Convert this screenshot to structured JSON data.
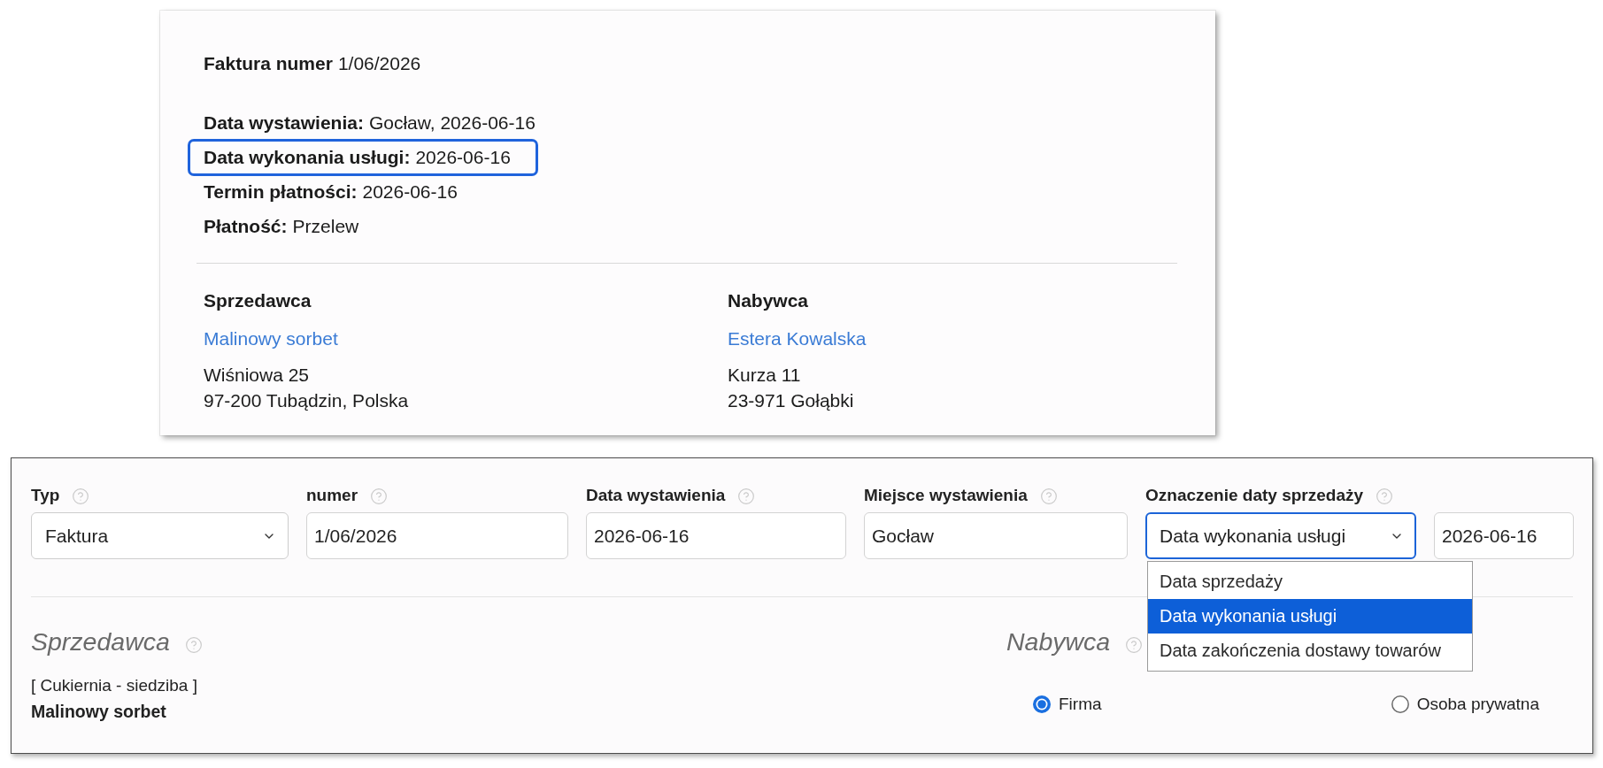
{
  "invoice_preview": {
    "title": {
      "label": "Faktura numer",
      "value": "1/06/2026"
    },
    "details": [
      {
        "label": "Data wystawienia:",
        "value": "Gocław, 2026-06-16",
        "highlighted": false
      },
      {
        "label": "Data wykonania usługi:",
        "value": "2026-06-16",
        "highlighted": true
      },
      {
        "label": "Termin płatności:",
        "value": "2026-06-16",
        "highlighted": false
      },
      {
        "label": "Płatność:",
        "value": "Przelew",
        "highlighted": false
      }
    ],
    "parties": [
      {
        "heading": "Sprzedawca",
        "name": "Malinowy sorbet",
        "address_lines": [
          "Wiśniowa 25",
          "97-200 Tubądzin, Polska"
        ]
      },
      {
        "heading": "Nabywca",
        "name": "Estera Kowalska",
        "address_lines": [
          "Kurza 11",
          "23-971 Gołąbki"
        ]
      }
    ]
  },
  "form": {
    "fields": [
      {
        "kind": "select",
        "label": "Typ",
        "value": "Faktura",
        "focused": false
      },
      {
        "kind": "input",
        "label": "numer",
        "value": "1/06/2026",
        "focused": false
      },
      {
        "kind": "input",
        "label": "Data wystawienia",
        "value": "2026-06-16",
        "focused": false
      },
      {
        "kind": "input",
        "label": "Miejsce wystawienia",
        "value": "Gocław",
        "focused": false
      },
      {
        "kind": "select",
        "label": "Oznaczenie daty sprzedaży",
        "value": "Data wykonania usługi",
        "focused": true,
        "expanded": true,
        "options": [
          {
            "label": "Data sprzedaży",
            "selected": false
          },
          {
            "label": "Data wykonania usługi",
            "selected": true
          },
          {
            "label": "Data zakończenia dostawy towarów",
            "selected": false
          }
        ]
      },
      {
        "kind": "input",
        "value": "2026-06-16",
        "focused": false
      }
    ],
    "seller": {
      "heading": "Sprzedawca",
      "branch": "[ Cukiernia - siedziba ]",
      "name": "Malinowy sorbet"
    },
    "buyer": {
      "heading": "Nabywca",
      "radios": [
        {
          "label": "Firma",
          "selected": true
        },
        {
          "label": "Osoba prywatna",
          "selected": false
        }
      ]
    }
  }
}
